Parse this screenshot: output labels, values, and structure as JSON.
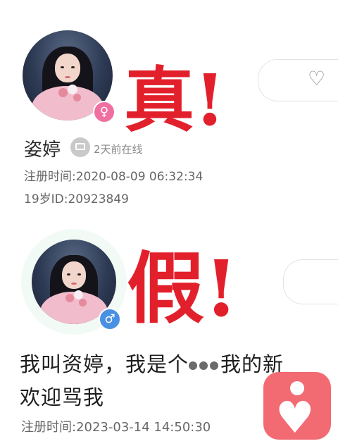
{
  "real_profile": {
    "verdict": "真!",
    "name": "姿婷",
    "online_status": "2天前在线",
    "register_time": "注册时间:2020-08-09 06:32:34",
    "age_id": "19岁ID:20923849",
    "gender_symbol": "♀",
    "gender_color": "#f06fa1"
  },
  "fake_profile": {
    "verdict": "假!",
    "bio_line1_before": "我叫资婷，我是个",
    "bio_line1_after": "我的新",
    "bio_line2": "欢迎骂我",
    "register_time": "注册时间:2023-03-14 14:50:30",
    "gender_symbol": "♂",
    "gender_color": "#4a90e2"
  },
  "icons": {
    "like": "heart-outline-icon",
    "message": "message-bubble-icon",
    "app_logo": "heart-person-logo"
  },
  "colors": {
    "verdict_red": "#e2202c",
    "logo_pink": "#f26a72"
  }
}
